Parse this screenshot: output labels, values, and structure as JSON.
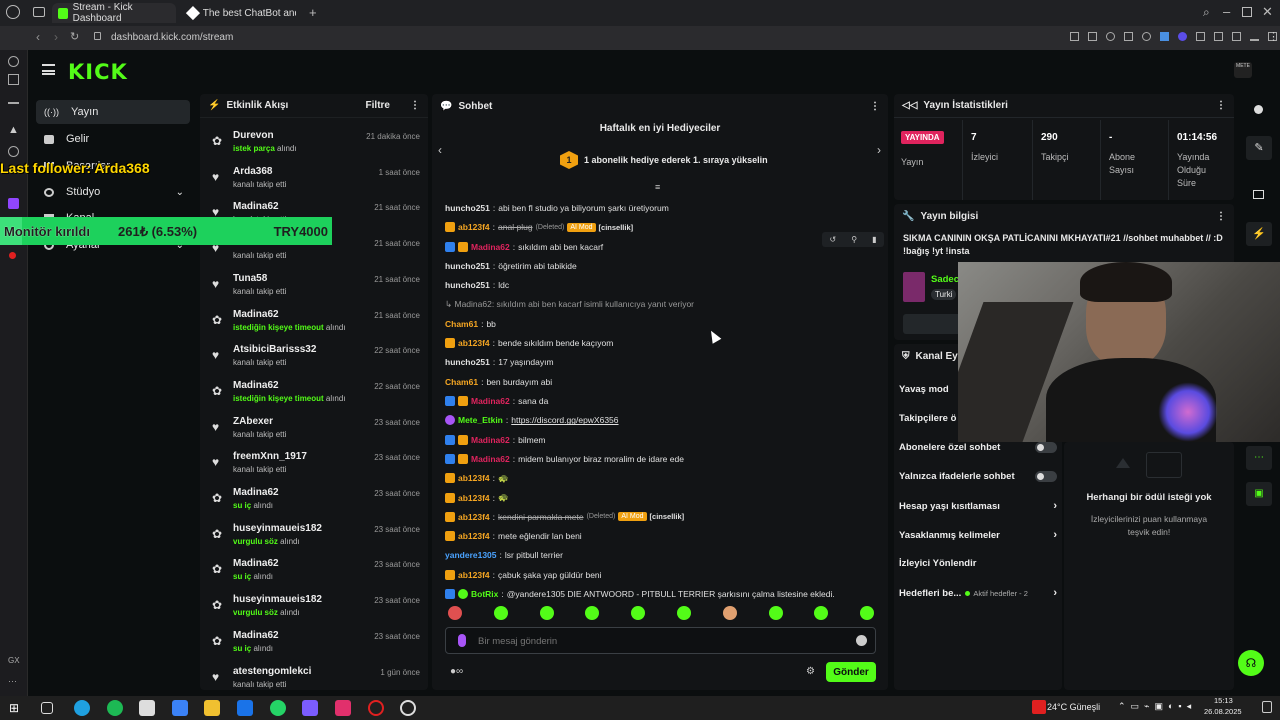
{
  "browser": {
    "tabs": [
      {
        "label": "Stream - Kick Dashboard"
      },
      {
        "label": "The best ChatBot and"
      }
    ],
    "url": "dashboard.kick.com/stream"
  },
  "app": {
    "logo": "KICK"
  },
  "nav": {
    "items": [
      {
        "label": "Yayın",
        "icon": "broadcast-icon"
      },
      {
        "label": "Gelir",
        "icon": "wallet-icon"
      },
      {
        "label": "Başarılar",
        "icon": "trophy-icon"
      },
      {
        "label": "Stüdyo",
        "icon": "studio-icon"
      },
      {
        "label": "Kanal",
        "icon": "channel-icon"
      },
      {
        "label": "Ayarlar",
        "icon": "gear-icon"
      }
    ]
  },
  "activity": {
    "title": "Etkinlik Akışı",
    "filter": "Filtre",
    "items": [
      {
        "name": "Durevon",
        "sub": "istek parça",
        "suffix": " alındı",
        "time": "21 dakika önce",
        "icon": "gift-icon"
      },
      {
        "name": "Arda368",
        "sub": "kanalı takip etti",
        "suffix": "",
        "time": "1 saat önce",
        "icon": "heart-icon"
      },
      {
        "name": "Madina62",
        "sub": "kanalı takip etti",
        "suffix": "",
        "time": "21 saat önce",
        "icon": "heart-icon"
      },
      {
        "name": "Madina62",
        "sub": "kanalı takip etti",
        "suffix": "",
        "time": "21 saat önce",
        "icon": "heart-icon"
      },
      {
        "name": "Tuna58",
        "sub": "kanalı takip etti",
        "suffix": "",
        "time": "21 saat önce",
        "icon": "heart-icon"
      },
      {
        "name": "Madina62",
        "sub": "istediğin kişeye timeout",
        "suffix": " alındı",
        "time": "21 saat önce",
        "icon": "gift-icon"
      },
      {
        "name": "AtsibiciBarisss32",
        "sub": "kanalı takip etti",
        "suffix": "",
        "time": "22 saat önce",
        "icon": "heart-icon"
      },
      {
        "name": "Madina62",
        "sub": "istediğin kişeye timeout",
        "suffix": " alındı",
        "time": "22 saat önce",
        "icon": "gift-icon"
      },
      {
        "name": "ZAbexer",
        "sub": "kanalı takip etti",
        "suffix": "",
        "time": "23 saat önce",
        "icon": "heart-icon"
      },
      {
        "name": "freemXnn_1917",
        "sub": "kanalı takip etti",
        "suffix": "",
        "time": "23 saat önce",
        "icon": "heart-icon"
      },
      {
        "name": "Madina62",
        "sub": "su iç",
        "suffix": " alındı",
        "time": "23 saat önce",
        "icon": "gift-icon"
      },
      {
        "name": "huseyinmaueis182",
        "sub": "vurgulu söz",
        "suffix": " alındı",
        "time": "23 saat önce",
        "icon": "gift-icon"
      },
      {
        "name": "Madina62",
        "sub": "su iç",
        "suffix": " alındı",
        "time": "23 saat önce",
        "icon": "gift-icon"
      },
      {
        "name": "huseyinmaueis182",
        "sub": "vurgulu söz",
        "suffix": " alındı",
        "time": "23 saat önce",
        "icon": "gift-icon"
      },
      {
        "name": "Madina62",
        "sub": "su iç",
        "suffix": " alındı",
        "time": "23 saat önce",
        "icon": "gift-icon"
      },
      {
        "name": "atestengomlekci",
        "sub": "kanalı takip etti",
        "suffix": "",
        "time": "1 gün önce",
        "icon": "heart-icon"
      }
    ]
  },
  "chat": {
    "title": "Sohbet",
    "gifter_title": "Haftalık en iyi Hediyeciler",
    "gifter_rank": "1",
    "gifter_text": "1 abonelik hediye ederek 1. sıraya yükselin",
    "messages": [
      {
        "user": "huncho251",
        "color": "#e0e0e0",
        "badges": [],
        "text": "abi ben fl studio ya biliyorum şarkı üretiyorum"
      },
      {
        "user": "ab123f4",
        "color": "#f5a623",
        "badges": [
          "gold"
        ],
        "text": "anal plug",
        "deleted": "(Deleted)",
        "tag": "AI Mod",
        "tag2": "[cinsellik]"
      },
      {
        "user": "Madina62",
        "color": "#e0245e",
        "badges": [
          "blue",
          "gold"
        ],
        "text": "sıkıldım abi ben kacarf"
      },
      {
        "user": "huncho251",
        "color": "#e0e0e0",
        "badges": [],
        "text": "öğretirim abi tabikide"
      },
      {
        "user": "huncho251",
        "color": "#e0e0e0",
        "badges": [],
        "text": "ldc"
      },
      {
        "user": "",
        "color": "#999",
        "badges": [],
        "text": "↳ Madina62: sıkıldım abi ben kacarf isimli kullanıcıya yanıt veriyor"
      },
      {
        "user": "Cham61",
        "color": "#f5a623",
        "badges": [],
        "text": "bb"
      },
      {
        "user": "ab123f4",
        "color": "#f5a623",
        "badges": [
          "gold"
        ],
        "text": "bende sıkıldım bende kaçıyom"
      },
      {
        "user": "huncho251",
        "color": "#e0e0e0",
        "badges": [],
        "text": "17 yaşındayım"
      },
      {
        "user": "Cham61",
        "color": "#f5a623",
        "badges": [],
        "text": "ben burdayım abi"
      },
      {
        "user": "Madina62",
        "color": "#e0245e",
        "badges": [
          "blue",
          "gold"
        ],
        "text": "sana da"
      },
      {
        "user": "Mete_Etkin",
        "color": "#53fc18",
        "badges": [
          "purple"
        ],
        "text": "https://discord.gg/epwX6356"
      },
      {
        "user": "Madina62",
        "color": "#e0245e",
        "badges": [
          "blue",
          "gold"
        ],
        "text": "bilmem"
      },
      {
        "user": "Madina62",
        "color": "#e0245e",
        "badges": [
          "blue",
          "gold"
        ],
        "text": "midem bulanıyor biraz moralim de idare ede"
      },
      {
        "user": "ab123f4",
        "color": "#f5a623",
        "badges": [
          "gold"
        ],
        "text": "🐢"
      },
      {
        "user": "ab123f4",
        "color": "#f5a623",
        "badges": [
          "gold"
        ],
        "text": "🐢"
      },
      {
        "user": "ab123f4",
        "color": "#f5a623",
        "badges": [
          "gold"
        ],
        "text": "kendini parmakla mete",
        "deleted": "(Deleted)",
        "tag": "AI Mod",
        "tag2": "[cinsellik]"
      },
      {
        "user": "ab123f4",
        "color": "#f5a623",
        "badges": [
          "gold"
        ],
        "text": "mete eğlendir lan beni"
      },
      {
        "user": "yandere1305",
        "color": "#4aa3ff",
        "badges": [],
        "text": "lsr pitbull terrier"
      },
      {
        "user": "ab123f4",
        "color": "#f5a623",
        "badges": [
          "gold"
        ],
        "text": "çabuk şaka yap güldür beni"
      },
      {
        "user": "BotRix",
        "color": "#53fc18",
        "badges": [
          "blue",
          "green"
        ],
        "text": "@yandere1305 DIE ANTWOORD - PITBULL TERRIER şarkısını çalma listesine ekledi."
      }
    ],
    "input_placeholder": "Bir mesaj gönderin",
    "send": "Gönder"
  },
  "stats": {
    "title": "Yayın İstatistikleri",
    "live_badge": "YAYINDA",
    "live_label": "Yayın",
    "items": [
      {
        "value": "7",
        "label": "İzleyici"
      },
      {
        "value": "290",
        "label": "Takipçi"
      },
      {
        "value": "-",
        "label": "Abone Sayısı"
      },
      {
        "value": "01:14:56",
        "label": "Yayında Olduğu Süre"
      }
    ]
  },
  "stream_info": {
    "title": "Yayın bilgisi",
    "text": "SIKMA CANININ OKŞA PATLİCANINI MKHAYATI#21 //sohbet muhabbet // :D !bağış !yt !insta",
    "category": "Sadec",
    "tag": "Turki"
  },
  "actions": {
    "title": "Kanal Eyle",
    "items": [
      {
        "label": "Yavaş mod",
        "kind": "toggle"
      },
      {
        "label": "Takipçilere ö",
        "kind": "toggle"
      },
      {
        "label": "Abonelere özel sohbet",
        "kind": "toggle"
      },
      {
        "label": "Yalnızca ifadelerle sohbet",
        "kind": "toggle"
      },
      {
        "label": "Hesap yaşı kısıtlaması",
        "kind": "chevron"
      },
      {
        "label": "Yasaklanmış kelimeler",
        "kind": "chevron"
      },
      {
        "label": "İzleyici Yönlendir",
        "kind": "none"
      },
      {
        "label": "Hedefleri be...",
        "kind": "chevron",
        "extra": "Aktif hedefler - 2"
      }
    ]
  },
  "rewards": {
    "title": "Herhangi bir ödül isteği yok",
    "text": "İzleyicilerinizi puan kullanmaya teşvik edin!"
  },
  "overlay": {
    "follower": "Last follower: Arda368",
    "goal_name": "Monitör kırıldı",
    "goal_amount": "261₺ (6.53%)",
    "goal_target": "TRY4000",
    "goal_progress": 0.0653
  },
  "taskbar": {
    "weather": "24°C Güneşli",
    "time": "15:13",
    "date": "26.08.2025"
  },
  "colors": {
    "accent": "#53fc18",
    "live": "#e0245e"
  }
}
